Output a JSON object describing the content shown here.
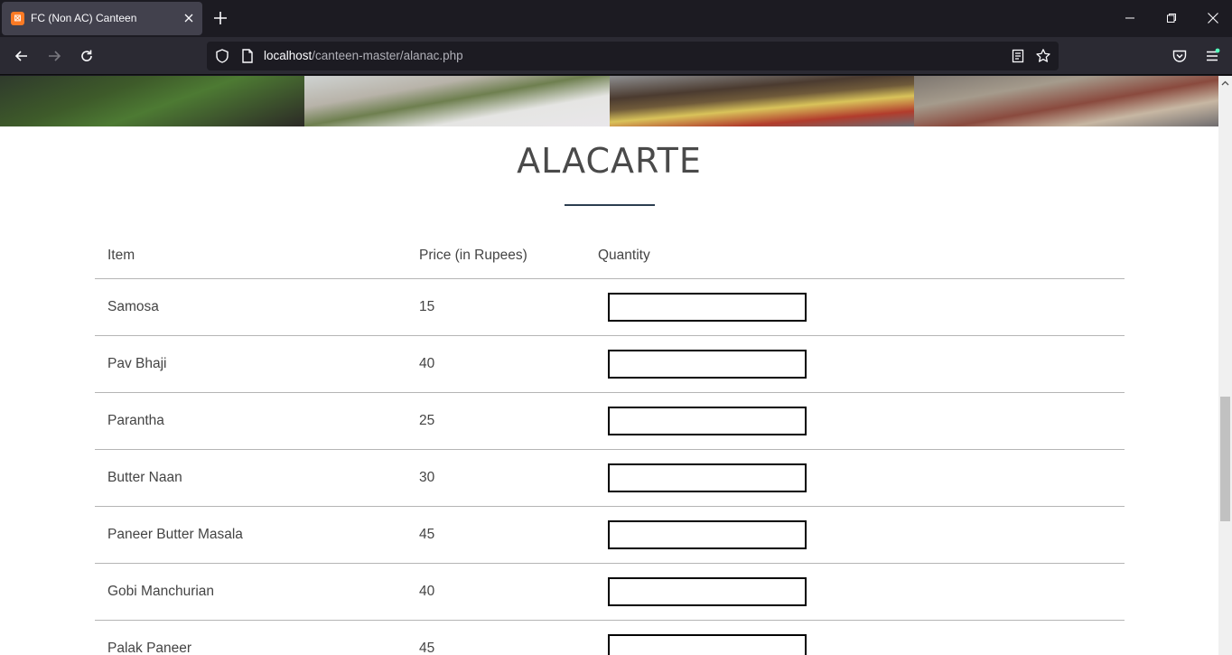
{
  "browser": {
    "tab_title": "FC (Non AC) Canteen",
    "url_host": "localhost",
    "url_path": "/canteen-master/alanac.php",
    "favicon_label": "ꙮ"
  },
  "page": {
    "heading": "ALACARTE",
    "table": {
      "headers": {
        "item": "Item",
        "price": "Price (in Rupees)",
        "quantity": "Quantity"
      },
      "rows": [
        {
          "item": "Samosa",
          "price": "15"
        },
        {
          "item": "Pav Bhaji",
          "price": "40"
        },
        {
          "item": "Parantha",
          "price": "25"
        },
        {
          "item": "Butter Naan",
          "price": "30"
        },
        {
          "item": "Paneer Butter Masala",
          "price": "45"
        },
        {
          "item": "Gobi Manchurian",
          "price": "40"
        },
        {
          "item": "Palak Paneer",
          "price": "45"
        }
      ]
    }
  },
  "colors": {
    "chrome_dark": "#1c1b22",
    "toolbar": "#2b2a33",
    "accent_rule": "#2c3e50",
    "text": "#444444"
  }
}
